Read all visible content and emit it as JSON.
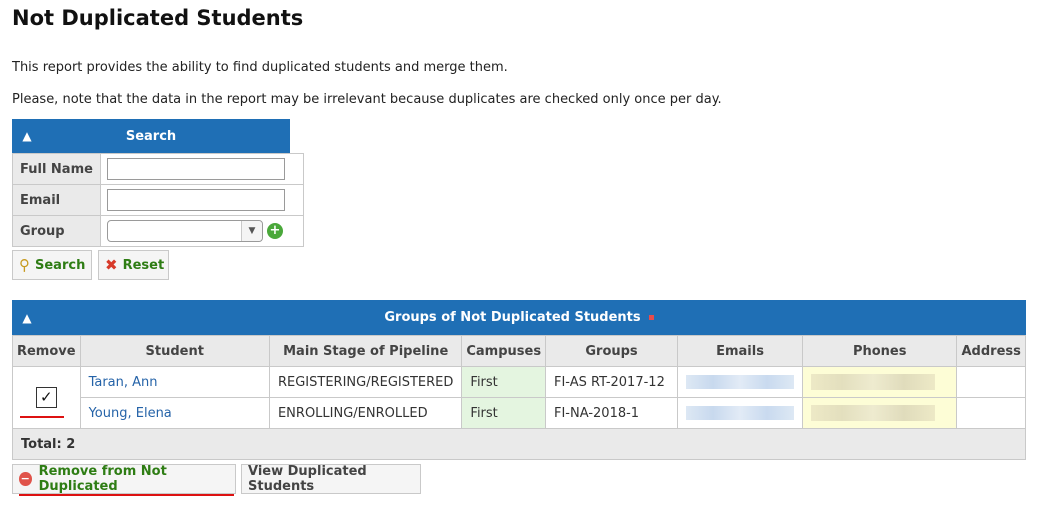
{
  "page": {
    "title": "Not Duplicated Students",
    "description_1": "This report provides the ability to find duplicated students and merge them.",
    "description_2": "Please, note that the data in the report may be irrelevant because duplicates are checked only once per day."
  },
  "search_panel": {
    "title": "Search",
    "fields": {
      "full_name_label": "Full Name",
      "full_name_value": "",
      "email_label": "Email",
      "email_value": "",
      "group_label": "Group",
      "group_value": ""
    },
    "search_button": "Search",
    "reset_button": "Reset"
  },
  "groups_panel": {
    "title": "Groups of Not Duplicated Students",
    "columns": [
      "Remove",
      "Student",
      "Main Stage of Pipeline",
      "Campuses",
      "Groups",
      "Emails",
      "Phones",
      "Address"
    ],
    "rows": [
      {
        "student": "Taran, Ann",
        "stage": "REGISTERING/REGISTERED",
        "campus": "First",
        "group": "FI-AS RT-2017-12",
        "address": ""
      },
      {
        "student": "Young, Elena",
        "stage": "ENROLLING/ENROLLED",
        "campus": "First",
        "group": "FI-NA-2018-1",
        "address": ""
      }
    ],
    "remove_checked": true,
    "total": "Total: 2"
  },
  "actions": {
    "remove_button": "Remove from Not Duplicated",
    "view_button": "View Duplicated Students"
  },
  "colors": {
    "header_blue": "#1f6fb5",
    "accent_green": "#2e7d14",
    "annotation_red": "#dd1111"
  },
  "icons": {
    "collapse": "chevron-up-icon",
    "search": "magnifier-icon",
    "reset": "red-x-icon",
    "add_group": "plus-circle-icon",
    "remove": "minus-circle-icon"
  }
}
